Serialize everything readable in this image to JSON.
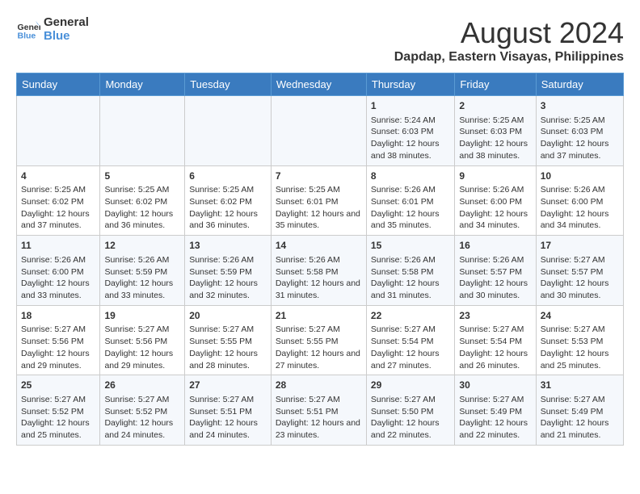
{
  "logo": {
    "line1": "General",
    "line2": "Blue"
  },
  "title": "August 2024",
  "location": "Dapdap, Eastern Visayas, Philippines",
  "days_of_week": [
    "Sunday",
    "Monday",
    "Tuesday",
    "Wednesday",
    "Thursday",
    "Friday",
    "Saturday"
  ],
  "weeks": [
    [
      {
        "day": "",
        "sunrise": "",
        "sunset": "",
        "daylight": ""
      },
      {
        "day": "",
        "sunrise": "",
        "sunset": "",
        "daylight": ""
      },
      {
        "day": "",
        "sunrise": "",
        "sunset": "",
        "daylight": ""
      },
      {
        "day": "",
        "sunrise": "",
        "sunset": "",
        "daylight": ""
      },
      {
        "day": "1",
        "sunrise": "Sunrise: 5:24 AM",
        "sunset": "Sunset: 6:03 PM",
        "daylight": "Daylight: 12 hours and 38 minutes."
      },
      {
        "day": "2",
        "sunrise": "Sunrise: 5:25 AM",
        "sunset": "Sunset: 6:03 PM",
        "daylight": "Daylight: 12 hours and 38 minutes."
      },
      {
        "day": "3",
        "sunrise": "Sunrise: 5:25 AM",
        "sunset": "Sunset: 6:03 PM",
        "daylight": "Daylight: 12 hours and 37 minutes."
      }
    ],
    [
      {
        "day": "4",
        "sunrise": "Sunrise: 5:25 AM",
        "sunset": "Sunset: 6:02 PM",
        "daylight": "Daylight: 12 hours and 37 minutes."
      },
      {
        "day": "5",
        "sunrise": "Sunrise: 5:25 AM",
        "sunset": "Sunset: 6:02 PM",
        "daylight": "Daylight: 12 hours and 36 minutes."
      },
      {
        "day": "6",
        "sunrise": "Sunrise: 5:25 AM",
        "sunset": "Sunset: 6:02 PM",
        "daylight": "Daylight: 12 hours and 36 minutes."
      },
      {
        "day": "7",
        "sunrise": "Sunrise: 5:25 AM",
        "sunset": "Sunset: 6:01 PM",
        "daylight": "Daylight: 12 hours and 35 minutes."
      },
      {
        "day": "8",
        "sunrise": "Sunrise: 5:26 AM",
        "sunset": "Sunset: 6:01 PM",
        "daylight": "Daylight: 12 hours and 35 minutes."
      },
      {
        "day": "9",
        "sunrise": "Sunrise: 5:26 AM",
        "sunset": "Sunset: 6:00 PM",
        "daylight": "Daylight: 12 hours and 34 minutes."
      },
      {
        "day": "10",
        "sunrise": "Sunrise: 5:26 AM",
        "sunset": "Sunset: 6:00 PM",
        "daylight": "Daylight: 12 hours and 34 minutes."
      }
    ],
    [
      {
        "day": "11",
        "sunrise": "Sunrise: 5:26 AM",
        "sunset": "Sunset: 6:00 PM",
        "daylight": "Daylight: 12 hours and 33 minutes."
      },
      {
        "day": "12",
        "sunrise": "Sunrise: 5:26 AM",
        "sunset": "Sunset: 5:59 PM",
        "daylight": "Daylight: 12 hours and 33 minutes."
      },
      {
        "day": "13",
        "sunrise": "Sunrise: 5:26 AM",
        "sunset": "Sunset: 5:59 PM",
        "daylight": "Daylight: 12 hours and 32 minutes."
      },
      {
        "day": "14",
        "sunrise": "Sunrise: 5:26 AM",
        "sunset": "Sunset: 5:58 PM",
        "daylight": "Daylight: 12 hours and 31 minutes."
      },
      {
        "day": "15",
        "sunrise": "Sunrise: 5:26 AM",
        "sunset": "Sunset: 5:58 PM",
        "daylight": "Daylight: 12 hours and 31 minutes."
      },
      {
        "day": "16",
        "sunrise": "Sunrise: 5:26 AM",
        "sunset": "Sunset: 5:57 PM",
        "daylight": "Daylight: 12 hours and 30 minutes."
      },
      {
        "day": "17",
        "sunrise": "Sunrise: 5:27 AM",
        "sunset": "Sunset: 5:57 PM",
        "daylight": "Daylight: 12 hours and 30 minutes."
      }
    ],
    [
      {
        "day": "18",
        "sunrise": "Sunrise: 5:27 AM",
        "sunset": "Sunset: 5:56 PM",
        "daylight": "Daylight: 12 hours and 29 minutes."
      },
      {
        "day": "19",
        "sunrise": "Sunrise: 5:27 AM",
        "sunset": "Sunset: 5:56 PM",
        "daylight": "Daylight: 12 hours and 29 minutes."
      },
      {
        "day": "20",
        "sunrise": "Sunrise: 5:27 AM",
        "sunset": "Sunset: 5:55 PM",
        "daylight": "Daylight: 12 hours and 28 minutes."
      },
      {
        "day": "21",
        "sunrise": "Sunrise: 5:27 AM",
        "sunset": "Sunset: 5:55 PM",
        "daylight": "Daylight: 12 hours and 27 minutes."
      },
      {
        "day": "22",
        "sunrise": "Sunrise: 5:27 AM",
        "sunset": "Sunset: 5:54 PM",
        "daylight": "Daylight: 12 hours and 27 minutes."
      },
      {
        "day": "23",
        "sunrise": "Sunrise: 5:27 AM",
        "sunset": "Sunset: 5:54 PM",
        "daylight": "Daylight: 12 hours and 26 minutes."
      },
      {
        "day": "24",
        "sunrise": "Sunrise: 5:27 AM",
        "sunset": "Sunset: 5:53 PM",
        "daylight": "Daylight: 12 hours and 25 minutes."
      }
    ],
    [
      {
        "day": "25",
        "sunrise": "Sunrise: 5:27 AM",
        "sunset": "Sunset: 5:52 PM",
        "daylight": "Daylight: 12 hours and 25 minutes."
      },
      {
        "day": "26",
        "sunrise": "Sunrise: 5:27 AM",
        "sunset": "Sunset: 5:52 PM",
        "daylight": "Daylight: 12 hours and 24 minutes."
      },
      {
        "day": "27",
        "sunrise": "Sunrise: 5:27 AM",
        "sunset": "Sunset: 5:51 PM",
        "daylight": "Daylight: 12 hours and 24 minutes."
      },
      {
        "day": "28",
        "sunrise": "Sunrise: 5:27 AM",
        "sunset": "Sunset: 5:51 PM",
        "daylight": "Daylight: 12 hours and 23 minutes."
      },
      {
        "day": "29",
        "sunrise": "Sunrise: 5:27 AM",
        "sunset": "Sunset: 5:50 PM",
        "daylight": "Daylight: 12 hours and 22 minutes."
      },
      {
        "day": "30",
        "sunrise": "Sunrise: 5:27 AM",
        "sunset": "Sunset: 5:49 PM",
        "daylight": "Daylight: 12 hours and 22 minutes."
      },
      {
        "day": "31",
        "sunrise": "Sunrise: 5:27 AM",
        "sunset": "Sunset: 5:49 PM",
        "daylight": "Daylight: 12 hours and 21 minutes."
      }
    ]
  ]
}
